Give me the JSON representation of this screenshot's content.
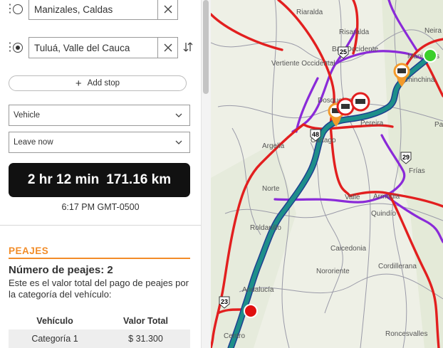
{
  "route": {
    "stops": [
      {
        "value": "Manizales, Caldas"
      },
      {
        "value": "Tuluá, Valle del Cauca"
      }
    ],
    "add_stop_label": "Add stop",
    "vehicle_select": "Vehicle",
    "depart_select": "Leave now"
  },
  "summary": {
    "duration": "2 hr 12 min",
    "distance": "171.16 km",
    "arrival": "6:17 PM GMT-0500"
  },
  "tolls": {
    "title": "PEAJES",
    "count_label": "Número de peajes: 2",
    "description": "Este es el valor total del pago de peajes por la categoría del vehículo:",
    "columns": [
      "Vehículo",
      "Valor Total"
    ],
    "rows": [
      {
        "vehicle": "Categoría 1",
        "total": "$ 31.300"
      }
    ]
  },
  "map": {
    "places": [
      "Riaralda",
      "Risaralda",
      "Bas Occidente",
      "Vertiente Occidental",
      "Neira",
      "Manizales",
      "Chinchiná",
      "Dosquebradas",
      "Pereira",
      "Cartago",
      "Argelia",
      "Norte",
      "Frías",
      "Valle",
      "Armenia",
      "Quindío",
      "Roldanillo",
      "Caicedonia",
      "Nororiente",
      "Cordillerana",
      "Andalucía",
      "Centro",
      "Roncesvalles",
      "Pa"
    ],
    "route_shields": [
      "25",
      "48",
      "29",
      "23"
    ],
    "colors": {
      "route": "#1e8f8a",
      "primary_road": "#e21f1f",
      "secondary_road": "#8a2ad8",
      "toll_marker": "#f39a2b",
      "origin_marker": "#3bcf2b",
      "destination_marker": "#e01010"
    }
  }
}
